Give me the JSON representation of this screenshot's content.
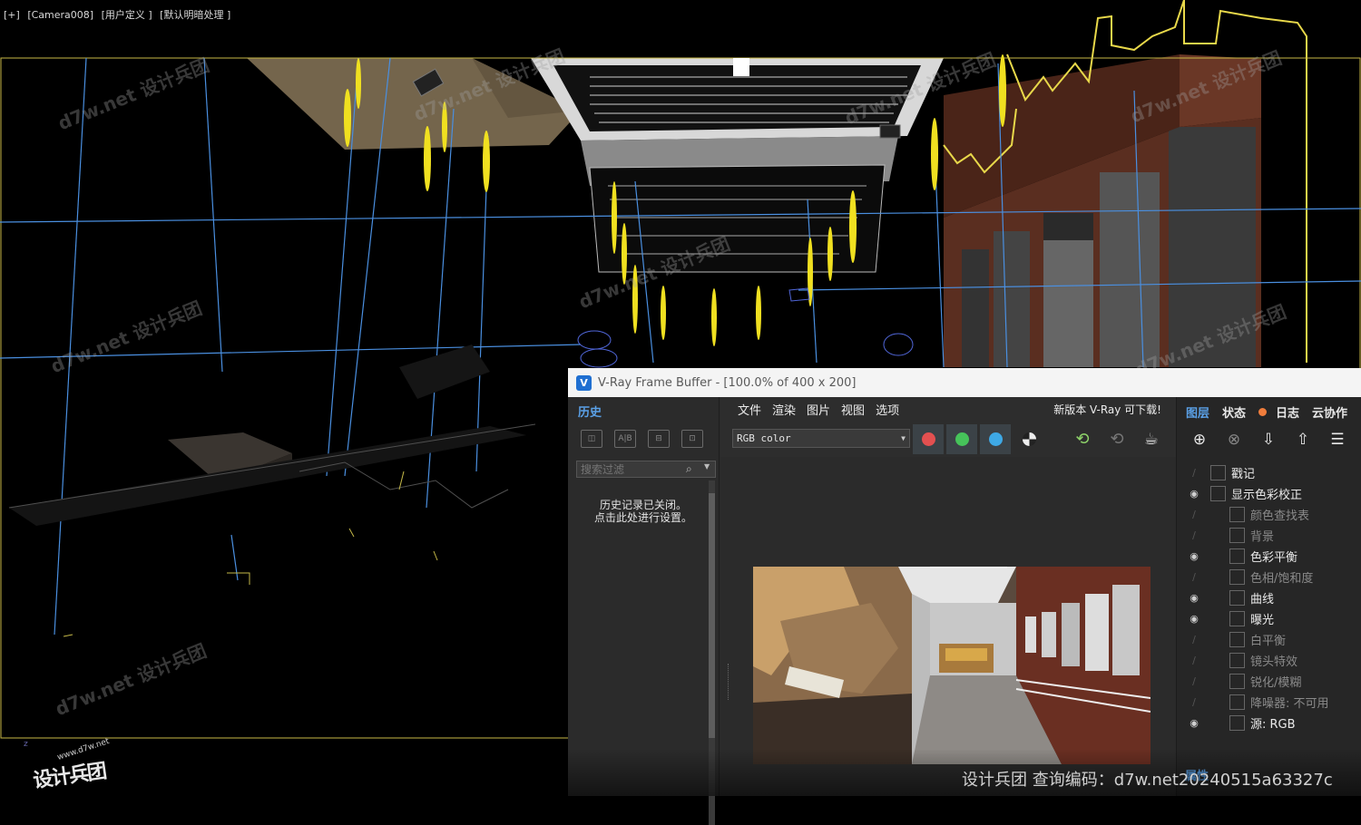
{
  "viewport": {
    "label_items": [
      "[+]",
      "[Camera008]",
      "[用户定义 ]",
      "[默认明暗处理 ]"
    ]
  },
  "watermark": "d7w.net 设计兵团",
  "brand": {
    "bottom_text": "设计兵团  查询编码：d7w.net20240515a63327c",
    "logo_url": "www.d7w.net",
    "logo_text": "设计兵团",
    "axis": "z"
  },
  "vfb": {
    "title": "V-Ray Frame Buffer - [100.0% of 400 x 200]",
    "logo": "V",
    "history": {
      "tab": "历史",
      "buttons": [
        "◫",
        "A|B",
        "⊟",
        "⊡"
      ],
      "search_placeholder": "搜索过滤",
      "message_line1": "历史记录已关闭。",
      "message_line2": "点击此处进行设置。"
    },
    "menu": [
      "文件",
      "渲染",
      "图片",
      "视图",
      "选项"
    ],
    "news": "新版本 V-Ray 可下载!",
    "channel": "RGB color",
    "channel_colors": {
      "red": "#e35050",
      "green": "#46c35a",
      "blue": "#3ea9e6"
    },
    "layers": {
      "tabs": [
        "图层",
        "状态",
        "日志",
        "云协作"
      ],
      "items": [
        {
          "label": "戳记",
          "visible": false,
          "indent": 0,
          "icon": "stamp-icon",
          "enabled": true
        },
        {
          "label": "显示色彩校正",
          "visible": true,
          "indent": 0,
          "icon": "display-correction-icon",
          "enabled": true
        },
        {
          "label": "颜色查找表",
          "visible": false,
          "indent": 1,
          "icon": "lut-icon",
          "enabled": false
        },
        {
          "label": "背景",
          "visible": false,
          "indent": 1,
          "icon": "background-icon",
          "enabled": false
        },
        {
          "label": "色彩平衡",
          "visible": true,
          "indent": 1,
          "icon": "color-balance-icon",
          "enabled": true
        },
        {
          "label": "色相/饱和度",
          "visible": false,
          "indent": 1,
          "icon": "hue-saturation-icon",
          "enabled": false
        },
        {
          "label": "曲线",
          "visible": true,
          "indent": 1,
          "icon": "curves-icon",
          "enabled": true
        },
        {
          "label": "曝光",
          "visible": true,
          "indent": 1,
          "icon": "exposure-icon",
          "enabled": true
        },
        {
          "label": "白平衡",
          "visible": false,
          "indent": 1,
          "icon": "white-balance-icon",
          "enabled": false
        },
        {
          "label": "镜头特效",
          "visible": false,
          "indent": 1,
          "icon": "lens-effects-icon",
          "enabled": false
        },
        {
          "label": "锐化/模糊",
          "visible": false,
          "indent": 1,
          "icon": "sharpen-blur-icon",
          "enabled": false
        },
        {
          "label": "降噪器: 不可用",
          "visible": false,
          "indent": 1,
          "icon": "denoiser-icon",
          "enabled": false
        },
        {
          "label": "源:  RGB",
          "visible": true,
          "indent": 1,
          "icon": "source-icon",
          "enabled": true
        }
      ],
      "properties": "属性"
    }
  }
}
